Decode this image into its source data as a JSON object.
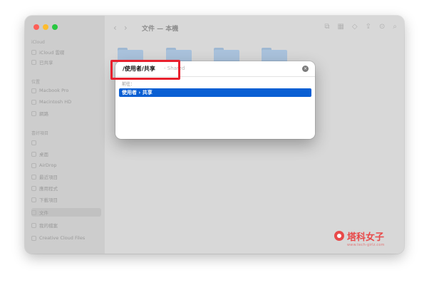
{
  "window": {
    "title": "文件 — 本機"
  },
  "sidebar": {
    "sections": [
      {
        "label": "iCloud",
        "items": [
          {
            "label": "iCloud 雲碟"
          },
          {
            "label": "已共享"
          }
        ]
      },
      {
        "label": "位置",
        "items": [
          {
            "label": "Macbook Pro"
          },
          {
            "label": "Macintosh HD"
          },
          {
            "label": "網路"
          }
        ]
      },
      {
        "label": "喜好項目",
        "items": [
          {
            "label": ""
          },
          {
            "label": "桌面"
          },
          {
            "label": "AirDrop"
          },
          {
            "label": "最近項目"
          },
          {
            "label": "應用程式"
          },
          {
            "label": "下載項目"
          },
          {
            "label": "文件",
            "selected": true
          },
          {
            "label": "我的檔案"
          },
          {
            "label": "Creative Cloud Files"
          }
        ]
      }
    ]
  },
  "dialog": {
    "path_typed": "/使用者/共享",
    "path_completion": " - Shared",
    "clear_icon": "×",
    "goto_label": "前往：",
    "suggestion": "使用者 › 共享"
  },
  "watermark": {
    "title": "塔科女子",
    "url": "www.tech-girlz.com"
  },
  "colors": {
    "highlight": "#e8212e",
    "selection": "#0a5fd3",
    "folder": "#a9c2dc"
  }
}
